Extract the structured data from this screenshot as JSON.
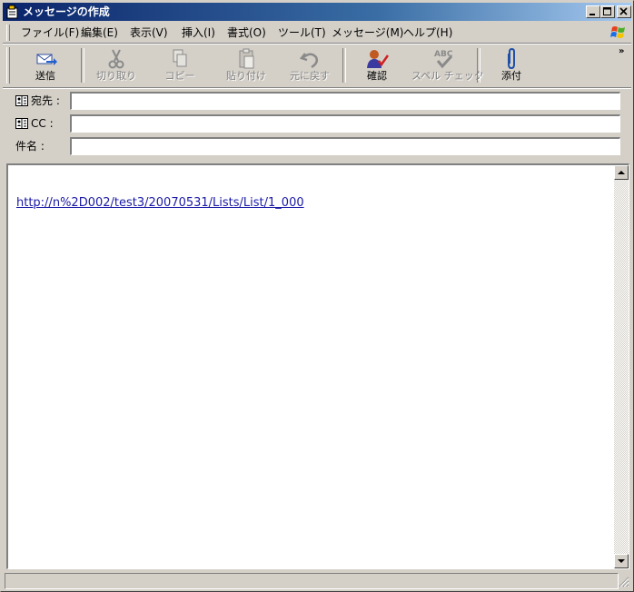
{
  "window": {
    "title": "メッセージの作成"
  },
  "menubar": {
    "items": [
      {
        "label": "ファイル(F)"
      },
      {
        "label": "編集(E)"
      },
      {
        "label": "表示(V)"
      },
      {
        "label": "挿入(I)"
      },
      {
        "label": "書式(O)"
      },
      {
        "label": "ツール(T)"
      },
      {
        "label": "メッセージ(M)"
      },
      {
        "label": "ヘルプ(H)"
      }
    ]
  },
  "toolbar": {
    "buttons": [
      {
        "label": "送信",
        "icon": "send-icon",
        "enabled": true
      },
      {
        "label": "切り取り",
        "icon": "scissors-icon",
        "enabled": false
      },
      {
        "label": "コピー",
        "icon": "copy-icon",
        "enabled": false
      },
      {
        "label": "貼り付け",
        "icon": "paste-icon",
        "enabled": false
      },
      {
        "label": "元に戻す",
        "icon": "undo-icon",
        "enabled": false
      },
      {
        "label": "確認",
        "icon": "check-names-icon",
        "enabled": true
      },
      {
        "label": "スペル チェック",
        "icon": "spell-check-icon",
        "enabled": false
      },
      {
        "label": "添付",
        "icon": "paperclip-icon",
        "enabled": true
      }
    ],
    "overflow": "»"
  },
  "fields": {
    "to": {
      "label": "宛先 :",
      "value": ""
    },
    "cc": {
      "label": "CC :",
      "value": ""
    },
    "subject": {
      "label": "件名 :",
      "value": ""
    }
  },
  "body": {
    "link": "http://n%2D002/test3/20070531/Lists/List/1_000"
  },
  "colors": {
    "titlebar_start": "#0a246a",
    "titlebar_end": "#a6caf0",
    "chrome": "#d4d0c8",
    "link": "#1a1aa6"
  }
}
